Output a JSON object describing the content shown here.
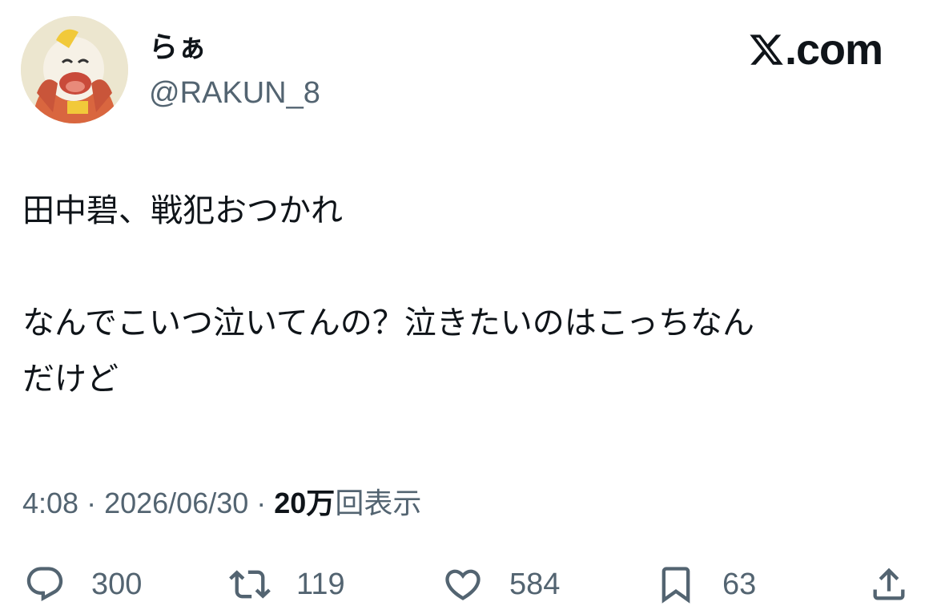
{
  "author": {
    "display_name": "らぁ",
    "handle": "@RAKUN_8"
  },
  "site_brand": {
    "text": ".com",
    "logo_icon": "x-logo-icon"
  },
  "tweet": {
    "paragraphs": [
      "田中碧、戦犯おつかれ",
      "なんでこいつ泣いてんの？泣きたいのはこっちなん\nだけど"
    ]
  },
  "meta": {
    "time": "4:08",
    "separator": " · ",
    "date": "2026/06/30",
    "views_count": "20万",
    "views_label": "回表示"
  },
  "actions": {
    "reply": {
      "icon": "reply-icon",
      "count": "300"
    },
    "retweet": {
      "icon": "retweet-icon",
      "count": "119"
    },
    "like": {
      "icon": "like-icon",
      "count": "584"
    },
    "bookmark": {
      "icon": "bookmark-icon",
      "count": "63"
    },
    "share": {
      "icon": "share-icon"
    }
  },
  "colors": {
    "text": "#0f1419",
    "secondary": "#536471",
    "background": "#ffffff"
  }
}
